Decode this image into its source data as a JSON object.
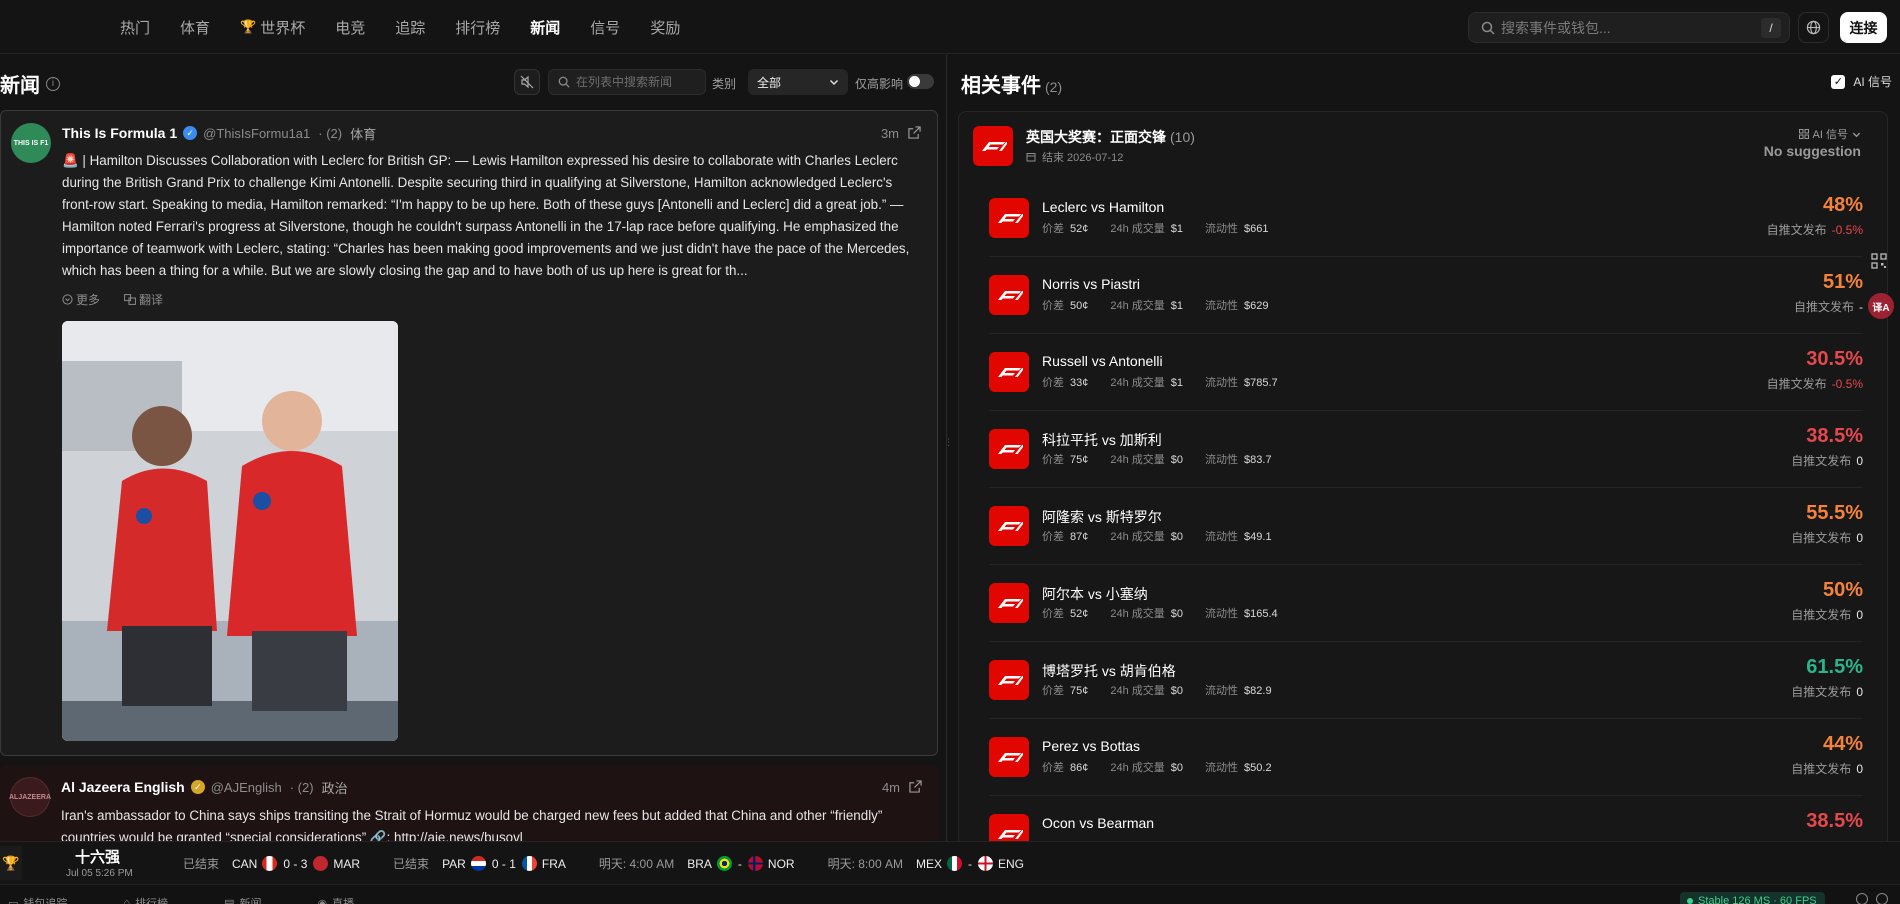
{
  "nav": {
    "items": [
      "热门",
      "体育",
      "世界杯",
      "电竞",
      "追踪",
      "排行榜",
      "新闻",
      "信号",
      "奖励"
    ],
    "active_index": 6,
    "search_placeholder": "搜索事件或钱包...",
    "search_shortcut": "/",
    "connect_label": "连接"
  },
  "news": {
    "title": "新闻",
    "info_icon": "i",
    "search_placeholder": "在列表中搜索新闻",
    "category_label": "类别",
    "category_value": "全部",
    "high_impact_label": "仅高影响",
    "cards": [
      {
        "avatar_text": "THIS IS F1",
        "author": "This Is Formula 1",
        "handle": "@ThisIsFormu1a1",
        "count": "· (2)",
        "category": "体育",
        "time": "3m",
        "body": "🚨 | Hamilton Discusses Collaboration with Leclerc for British GP: — Lewis Hamilton expressed his desire to collaborate with Charles Leclerc during the British Grand Prix to challenge Kimi Antonelli. Despite securing third in qualifying at Silverstone, Hamilton acknowledged Leclerc's front-row start. Speaking to media, Hamilton remarked: “I'm happy to be up here. Both of these guys [Antonelli and Leclerc] did a great job.” — Hamilton noted Ferrari's progress at Silverstone, though he couldn't surpass Antonelli in the 17-lap race before qualifying. He emphasized the importance of teamwork with Leclerc, stating: “Charles has been making good improvements and we just didn't have the pace of the Mercedes, which has been a thing for a while. But we are slowly closing the gap and to have both of us up here is great for th...",
        "more_label": "更多",
        "translate_label": "翻译"
      },
      {
        "avatar_text": "ALJAZEERA",
        "author": "Al Jazeera English",
        "handle": "@AJEnglish",
        "count": "· (2)",
        "category": "政治",
        "time": "4m",
        "body": "Iran's ambassador to China says ships transiting the Strait of Hormuz would be charged new fees but added that China and other “friendly” countries would be granted “special considerations” 🔗: http://aje.news/busovl"
      }
    ]
  },
  "events": {
    "title": "相关事件",
    "count": "(2)",
    "ai_signal_label": "AI 信号",
    "event": {
      "title": "英国大奖赛：正面交锋",
      "count": "(10)",
      "end_label": "结束 2026-07-12",
      "ai_label": "AI 信号",
      "suggestion": "No suggestion"
    },
    "labels": {
      "spread": "价差",
      "volume": "24h 成交量",
      "liquidity": "流动性",
      "since_post": "自推文发布"
    },
    "markets": [
      {
        "name": "Leclerc vs Hamilton",
        "spread": "52¢",
        "volume": "$1",
        "liquidity": "$661",
        "pct": "48%",
        "change": "-0.5%",
        "color": "#f5823b"
      },
      {
        "name": "Norris vs Piastri",
        "spread": "50¢",
        "volume": "$1",
        "liquidity": "$629",
        "pct": "51%",
        "change": "-",
        "color": "#f5823b"
      },
      {
        "name": "Russell vs Antonelli",
        "spread": "33¢",
        "volume": "$1",
        "liquidity": "$785.7",
        "pct": "30.5%",
        "change": "-0.5%",
        "color": "#e5484d"
      },
      {
        "name": "科拉平托 vs 加斯利",
        "spread": "75¢",
        "volume": "$0",
        "liquidity": "$83.7",
        "pct": "38.5%",
        "change": "0",
        "color": "#e5484d"
      },
      {
        "name": "阿隆索 vs 斯特罗尔",
        "spread": "87¢",
        "volume": "$0",
        "liquidity": "$49.1",
        "pct": "55.5%",
        "change": "0",
        "color": "#f5823b"
      },
      {
        "name": "阿尔本 vs 小塞纳",
        "spread": "52¢",
        "volume": "$0",
        "liquidity": "$165.4",
        "pct": "50%",
        "change": "0",
        "color": "#f5823b"
      },
      {
        "name": "博塔罗托 vs 胡肯伯格",
        "spread": "75¢",
        "volume": "$0",
        "liquidity": "$82.9",
        "pct": "61.5%",
        "change": "0",
        "color": "#2bb58a"
      },
      {
        "name": "Perez vs Bottas",
        "spread": "86¢",
        "volume": "$0",
        "liquidity": "$50.2",
        "pct": "44%",
        "change": "0",
        "color": "#f5823b"
      },
      {
        "name": "Ocon vs Bearman",
        "spread": "",
        "volume": "",
        "liquidity": "",
        "pct": "38.5%",
        "change": "",
        "color": "#e5484d"
      }
    ]
  },
  "ticker": {
    "round": "十六强",
    "date": "Jul 05 5:26 PM",
    "matches": [
      {
        "status": "已结束",
        "home": "CAN",
        "score": "0 - 3",
        "away": "MAR"
      },
      {
        "status": "已结束",
        "home": "PAR",
        "score": "0 - 1",
        "away": "FRA"
      },
      {
        "status": "明天: 4:00 AM",
        "home": "BRA",
        "score": "-",
        "away": "NOR"
      },
      {
        "status": "明天: 8:00 AM",
        "home": "MEX",
        "score": "-",
        "away": "ENG"
      }
    ]
  },
  "statusbar": {
    "items": [
      "钱包追踪",
      "排行榜",
      "新闻",
      "直播"
    ],
    "stable": "Stable 126 MS · 60 FPS"
  }
}
